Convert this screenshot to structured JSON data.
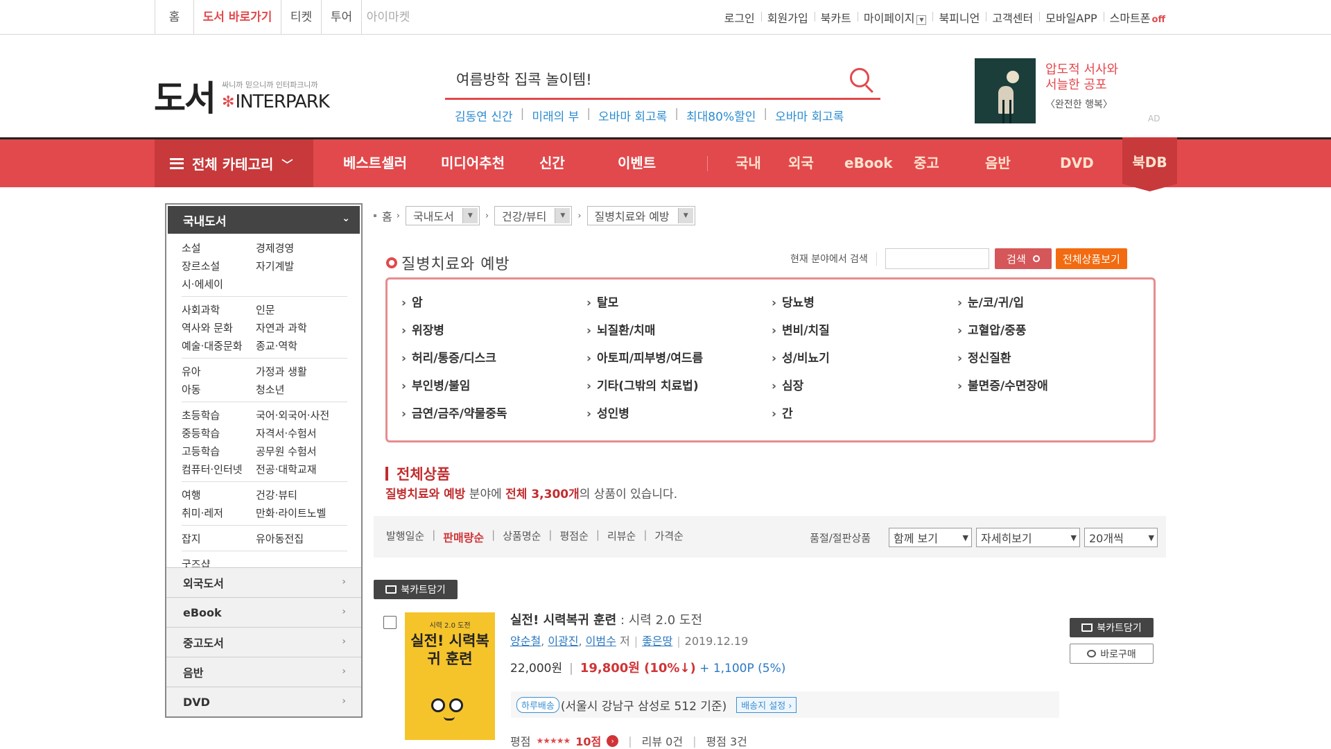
{
  "top_tabs": [
    {
      "label": "홈"
    },
    {
      "label": "도서 바로가기"
    },
    {
      "label": "티켓"
    },
    {
      "label": "투어"
    },
    {
      "label": "아이마켓"
    }
  ],
  "top_links": {
    "login": "로그인",
    "signup": "회원가입",
    "bookcart": "북카트",
    "mypage": "마이페이지",
    "bookpinion": "북피니언",
    "customer": "고객센터",
    "mobile_app": "모바일APP",
    "smart_label": "스마트폰",
    "smart_status": "off"
  },
  "logo": {
    "title": "도서",
    "tagline": "싸니까 믿으니까 인터파크니까",
    "brand": "INTERPARK"
  },
  "search": {
    "value": "여름방학 집콕 놀이템!",
    "keywords": [
      "김동연 신간",
      "미래의 부",
      "오바마 회고록",
      "최대80%할인",
      "오바마 회고록"
    ]
  },
  "ad": {
    "line1": "압도적 서사와",
    "line2": "서늘한 공포",
    "subtitle": "〈완전한 행복〉",
    "tag": "AD"
  },
  "nav": {
    "all_category": "전체 카테고리",
    "items": [
      "베스트셀러",
      "미디어추천",
      "신간",
      "이벤트"
    ],
    "secondary": [
      "국내",
      "외국",
      "eBook",
      "중고",
      "음반",
      "DVD"
    ],
    "bookdb": "북DB"
  },
  "sidebar": {
    "head": "국내도서",
    "groups": [
      [
        [
          "소설",
          "경제경영"
        ],
        [
          "장르소설",
          "자기계발"
        ],
        [
          "시·에세이",
          ""
        ]
      ],
      [
        [
          "사회과학",
          "인문"
        ],
        [
          "역사와 문화",
          "자연과 과학"
        ],
        [
          "예술·대중문화",
          "종교·역학"
        ]
      ],
      [
        [
          "유아",
          "가정과 생활"
        ],
        [
          "아동",
          "청소년"
        ]
      ],
      [
        [
          "초등학습",
          "국어·외국어·사전"
        ],
        [
          "중등학습",
          "자격서·수험서"
        ],
        [
          "고등학습",
          "공무원 수험서"
        ],
        [
          "컴퓨터·인터넷",
          "전공·대학교재"
        ]
      ],
      [
        [
          "여행",
          "건강·뷰티"
        ],
        [
          "취미·레저",
          "만화·라이트노벨"
        ]
      ],
      [
        [
          "잡지",
          "유아동전집"
        ]
      ],
      [
        [
          "굿즈샵",
          ""
        ]
      ]
    ],
    "menus": [
      "외국도서",
      "eBook",
      "중고도서",
      "음반",
      "DVD"
    ]
  },
  "breadcrumb": {
    "home": "홈",
    "level1": "국내도서",
    "level2": "건강/뷰티",
    "level3": "질병치료와 예방"
  },
  "category": {
    "title": "질병치료와 예방",
    "search_label": "현재 분야에서 검색",
    "search_button": "검색",
    "all_button": "전체상품보기",
    "links": [
      "암",
      "탈모",
      "당뇨병",
      "눈/코/귀/입",
      "위장병",
      "뇌질환/치매",
      "변비/치질",
      "고혈압/중풍",
      "허리/통증/디스크",
      "아토피/피부병/여드름",
      "성/비뇨기",
      "정신질환",
      "부인병/불임",
      "기타(그밖의 치료법)",
      "심장",
      "불면증/수면장애",
      "금연/금주/약물중독",
      "성인병",
      "간"
    ]
  },
  "all_products": {
    "title": "전체상품",
    "desc_cat": "질병치료와 예방",
    "desc_mid": " 분야에 ",
    "desc_count": "전체 3,300개",
    "desc_end": "의 상품이 있습니다."
  },
  "sort": {
    "options": [
      "발행일순",
      "판매량순",
      "상품명순",
      "평점순",
      "리뷰순",
      "가격순"
    ],
    "active": "판매량순",
    "soldout_label": "품절/절판상품",
    "select_view": "함께 보기",
    "select_detail": "자세히보기",
    "select_count": "20개씩"
  },
  "cart_button": "북카트담기",
  "item": {
    "cover_top": "시력 2.0 도전",
    "cover_title": "실전! 시력복귀 훈련",
    "title": "실전! 시력복귀 훈련",
    "subtitle": " : 시력 2.0 도전",
    "authors": [
      "양순철",
      "이광진",
      "이범수"
    ],
    "author_suffix": "저",
    "publisher": "좋은땅",
    "date": "2019.12.19",
    "price": "22,000원",
    "sale_price": "19,800원 (10%↓)",
    "points": "+ 1,100P (5%)",
    "delivery_badge": "하루배송",
    "delivery_text": "(서울시 강남구 삼성로 512 기준)",
    "delivery_setting": "배송지 설정 ›",
    "rating_label": "평점",
    "stars": "★★★★★",
    "rating_count": "10점",
    "reviews": "리뷰 0건",
    "rating_total": "평점 3건",
    "cart_label": "북카트담기",
    "buy_label": "바로구매"
  }
}
